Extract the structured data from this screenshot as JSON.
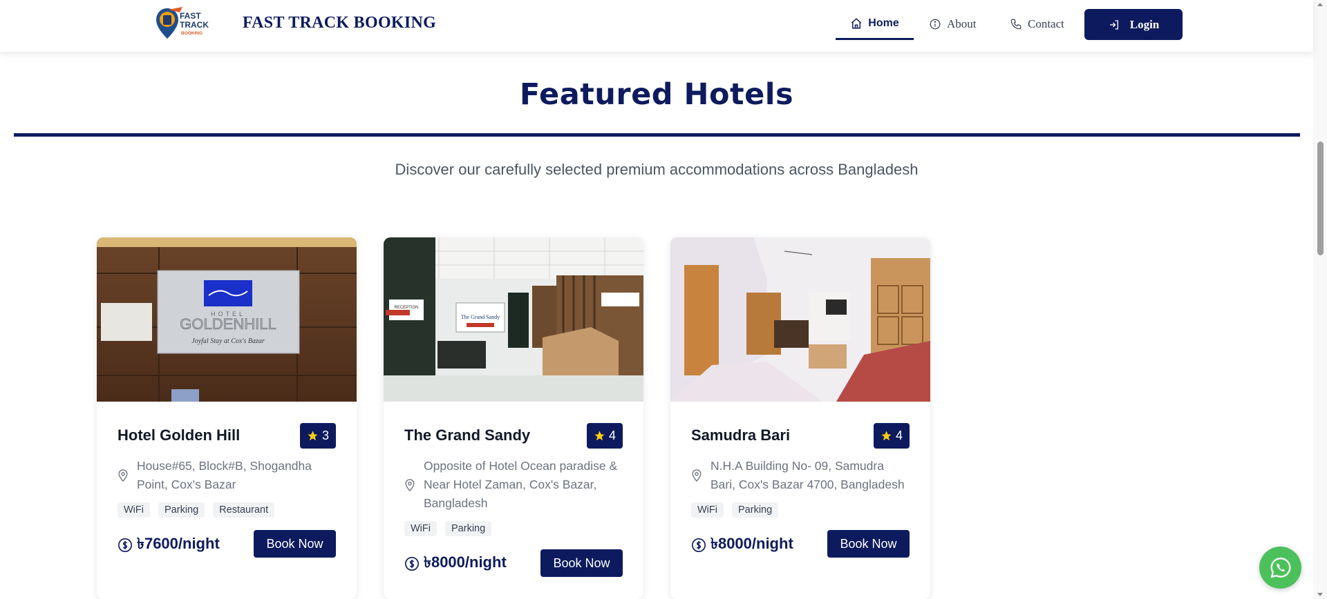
{
  "header": {
    "logo_text": [
      "FAST",
      "TRACK",
      "BOOKING"
    ],
    "brand": "FAST TRACK BOOKING",
    "nav": {
      "home": "Home",
      "about": "About",
      "contact": "Contact",
      "login": "Login"
    }
  },
  "section": {
    "title": "Featured Hotels",
    "subtitle": "Discover our carefully selected premium accommodations across Bangladesh"
  },
  "hotels": [
    {
      "name": "Hotel Golden Hill",
      "rating": "3",
      "address": "House#65, Block#B, Shogandha Point, Cox's Bazar",
      "amenities": [
        "WiFi",
        "Parking",
        "Restaurant"
      ],
      "price": "৳7600/night",
      "book_label": "Book Now",
      "image_sign": {
        "line1": "HOTEL",
        "line2": "GOLDENHILL",
        "line3": "Joyful Stay at Cox's Bazar"
      }
    },
    {
      "name": "The Grand Sandy",
      "rating": "4",
      "address": "Opposite of Hotel Ocean paradise & Near Hotel Zaman, Cox's Bazar, Bangladesh",
      "amenities": [
        "WiFi",
        "Parking"
      ],
      "price": "৳8000/night",
      "book_label": "Book Now",
      "image_sign": {
        "line1": "RECEPTION",
        "line2": "The Grand Sandy"
      }
    },
    {
      "name": "Samudra Bari",
      "rating": "4",
      "address": "N.H.A Building No- 09, Samudra Bari, Cox's Bazar 4700, Bangladesh",
      "amenities": [
        "WiFi",
        "Parking"
      ],
      "price": "৳8000/night",
      "book_label": "Book Now"
    }
  ],
  "colors": {
    "primary": "#0d1b5e",
    "whatsapp": "#4cc15b",
    "star": "#facc15"
  }
}
